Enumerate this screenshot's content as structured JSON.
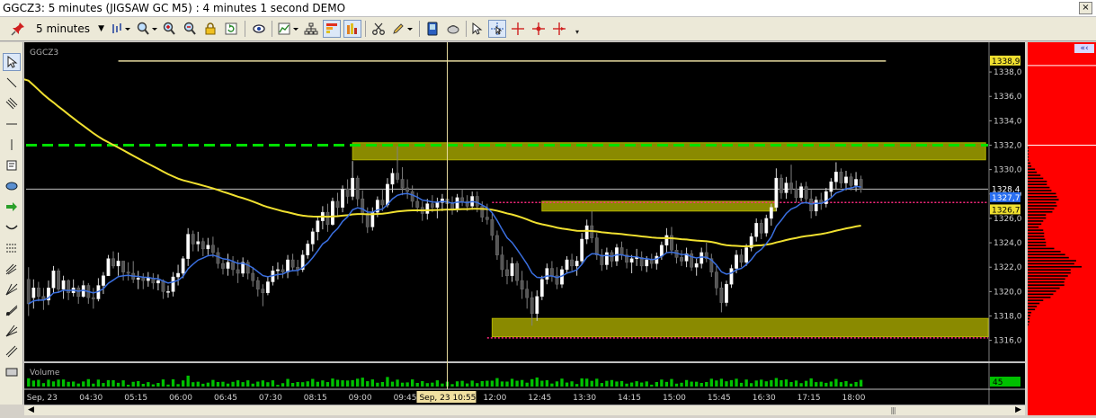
{
  "window": {
    "title": "GGCZ3: 5 minutes (JIGSAW GC M5) : 4 minutes 1 second DEMO",
    "close_label": "×"
  },
  "toolbar": {
    "interval": "5 minutes",
    "buttons": [
      "pin-icon",
      "bar-type-icon",
      "zoom-icon",
      "zoom-in-icon",
      "zoom-out-icon",
      "lock-icon",
      "refresh-icon",
      "eye-icon",
      "chart-type-icon",
      "hierarchy-icon",
      "grid-colors-icon",
      "columns-icon",
      "scissors-icon",
      "pencil-icon",
      "bell-icon",
      "phone-icon",
      "eraser-icon",
      "cursor-icon",
      "crosshair-icon",
      "crosshair-dot-icon",
      "crosshair-arrow-icon",
      "more-icon"
    ]
  },
  "chart": {
    "symbol": "GGCZ3",
    "volume_label": "Volume",
    "volume_value": "45",
    "price_labels": [
      "1338,0",
      "1336,0",
      "1334,0",
      "1332,0",
      "1330,0",
      "1328,0",
      "1326,0",
      "1324,0",
      "1322,0",
      "1320,0",
      "1318,0",
      "1316,0"
    ],
    "markers": {
      "high": "1338,9",
      "last": "1328,4",
      "ma_fast": "1327,7",
      "ma_slow": "1326,7"
    },
    "time_labels": [
      "Sep, 23",
      "04:30",
      "05:15",
      "06:00",
      "06:45",
      "07:30",
      "08:15",
      "09:00",
      "09:45",
      "12:00",
      "12:45",
      "13:30",
      "14:15",
      "15:00",
      "15:45",
      "16:30",
      "17:15",
      "18:00"
    ],
    "crosshair_time": "Sep, 23 10:55",
    "colors": {
      "background": "#000000",
      "up_candle": "#ffffff",
      "down_candle": "#555555",
      "ma_slow": "#f0e030",
      "ma_fast": "#3a6fe0",
      "zone": "#8a8a00",
      "dashed_line": "#00e000",
      "dotted_line": "#ff2a80",
      "volume": "#00c000",
      "profile": "#000000"
    }
  },
  "chart_data": {
    "type": "candlestick",
    "y_range": [
      1314.5,
      1339.7
    ],
    "x_range": [
      0,
      193
    ],
    "x_tick_indices": [
      0,
      12,
      21,
      30,
      39,
      48,
      57,
      66,
      75,
      93,
      102,
      111,
      120,
      129,
      138,
      147,
      156,
      165
    ],
    "crosshair_index": 84,
    "last_index": 170,
    "levels": {
      "high_line": 1338.9,
      "dashed_resistance": 1332.0,
      "last_price_line": 1328.4,
      "dotted_line_1": 1327.3,
      "dotted_line_2": 1316.2
    },
    "zones": [
      {
        "x": [
          65,
          192
        ],
        "y": [
          1330.8,
          1332.2
        ]
      },
      {
        "x": [
          103,
          150
        ],
        "y": [
          1326.6,
          1327.4
        ]
      },
      {
        "x": [
          93,
          198
        ],
        "y": [
          1316.3,
          1317.8
        ]
      }
    ],
    "candles": [
      {
        "o": 1321.0,
        "h": 1322.0,
        "l": 1318.0,
        "c": 1319.0
      },
      {
        "o": 1319.5,
        "h": 1321.0,
        "l": 1318.6,
        "c": 1320.3
      },
      {
        "o": 1320.3,
        "h": 1320.8,
        "l": 1319.2,
        "c": 1319.6
      },
      {
        "o": 1319.6,
        "h": 1320.3,
        "l": 1318.5,
        "c": 1319.3
      },
      {
        "o": 1319.3,
        "h": 1320.9,
        "l": 1318.9,
        "c": 1320.3
      },
      {
        "o": 1320.3,
        "h": 1322.1,
        "l": 1319.9,
        "c": 1321.7
      },
      {
        "o": 1321.7,
        "h": 1321.9,
        "l": 1319.9,
        "c": 1320.2
      },
      {
        "o": 1320.2,
        "h": 1321.3,
        "l": 1319.4,
        "c": 1320.9
      },
      {
        "o": 1320.9,
        "h": 1321.0,
        "l": 1319.3,
        "c": 1319.9
      },
      {
        "o": 1319.9,
        "h": 1321.0,
        "l": 1319.6,
        "c": 1320.3
      },
      {
        "o": 1320.3,
        "h": 1320.5,
        "l": 1319.0,
        "c": 1319.6
      },
      {
        "o": 1319.6,
        "h": 1320.9,
        "l": 1319.5,
        "c": 1320.5
      },
      {
        "o": 1320.5,
        "h": 1320.7,
        "l": 1319.0,
        "c": 1319.5
      },
      {
        "o": 1319.5,
        "h": 1320.3,
        "l": 1318.6,
        "c": 1319.4
      },
      {
        "o": 1319.4,
        "h": 1321.1,
        "l": 1319.2,
        "c": 1320.5
      },
      {
        "o": 1320.5,
        "h": 1321.6,
        "l": 1319.8,
        "c": 1321.3
      },
      {
        "o": 1321.3,
        "h": 1323.0,
        "l": 1321.3,
        "c": 1322.7
      },
      {
        "o": 1322.7,
        "h": 1323.3,
        "l": 1321.9,
        "c": 1322.1
      },
      {
        "o": 1322.1,
        "h": 1323.2,
        "l": 1321.3,
        "c": 1322.5
      },
      {
        "o": 1322.5,
        "h": 1322.5,
        "l": 1320.9,
        "c": 1321.6
      },
      {
        "o": 1321.6,
        "h": 1322.4,
        "l": 1320.9,
        "c": 1321.5
      },
      {
        "o": 1321.5,
        "h": 1322.5,
        "l": 1320.7,
        "c": 1321.0
      },
      {
        "o": 1321.0,
        "h": 1321.7,
        "l": 1320.2,
        "c": 1321.1
      },
      {
        "o": 1321.1,
        "h": 1321.5,
        "l": 1320.2,
        "c": 1320.9
      },
      {
        "o": 1320.9,
        "h": 1321.6,
        "l": 1320.4,
        "c": 1321.1
      },
      {
        "o": 1321.1,
        "h": 1321.5,
        "l": 1320.2,
        "c": 1320.7
      },
      {
        "o": 1320.7,
        "h": 1321.4,
        "l": 1320.1,
        "c": 1320.9
      },
      {
        "o": 1320.9,
        "h": 1321.0,
        "l": 1319.4,
        "c": 1320.0
      },
      {
        "o": 1320.0,
        "h": 1320.5,
        "l": 1319.5,
        "c": 1320.0
      },
      {
        "o": 1320.0,
        "h": 1321.6,
        "l": 1319.6,
        "c": 1321.2
      },
      {
        "o": 1321.2,
        "h": 1322.2,
        "l": 1320.5,
        "c": 1321.5
      },
      {
        "o": 1321.5,
        "h": 1322.9,
        "l": 1321.1,
        "c": 1322.7
      },
      {
        "o": 1322.7,
        "h": 1325.2,
        "l": 1322.1,
        "c": 1324.7
      },
      {
        "o": 1324.7,
        "h": 1325.0,
        "l": 1323.3,
        "c": 1323.9
      },
      {
        "o": 1323.9,
        "h": 1324.9,
        "l": 1323.3,
        "c": 1324.1
      },
      {
        "o": 1324.1,
        "h": 1324.4,
        "l": 1322.9,
        "c": 1323.5
      },
      {
        "o": 1323.5,
        "h": 1324.4,
        "l": 1323.0,
        "c": 1323.8
      },
      {
        "o": 1323.8,
        "h": 1324.5,
        "l": 1322.8,
        "c": 1323.2
      },
      {
        "o": 1323.2,
        "h": 1323.6,
        "l": 1321.9,
        "c": 1322.3
      },
      {
        "o": 1322.3,
        "h": 1322.6,
        "l": 1321.4,
        "c": 1321.9
      },
      {
        "o": 1321.9,
        "h": 1323.1,
        "l": 1321.3,
        "c": 1322.4
      },
      {
        "o": 1322.4,
        "h": 1322.9,
        "l": 1321.3,
        "c": 1321.8
      },
      {
        "o": 1321.8,
        "h": 1322.6,
        "l": 1320.7,
        "c": 1321.5
      },
      {
        "o": 1321.5,
        "h": 1322.8,
        "l": 1321.2,
        "c": 1322.4
      },
      {
        "o": 1322.4,
        "h": 1322.6,
        "l": 1321.0,
        "c": 1321.5
      },
      {
        "o": 1321.5,
        "h": 1322.0,
        "l": 1320.4,
        "c": 1320.9
      },
      {
        "o": 1320.9,
        "h": 1321.2,
        "l": 1319.6,
        "c": 1320.2
      },
      {
        "o": 1320.2,
        "h": 1320.6,
        "l": 1318.8,
        "c": 1319.9
      },
      {
        "o": 1319.9,
        "h": 1321.2,
        "l": 1319.7,
        "c": 1320.8
      },
      {
        "o": 1320.8,
        "h": 1322.1,
        "l": 1320.5,
        "c": 1321.7
      },
      {
        "o": 1321.7,
        "h": 1322.4,
        "l": 1321.0,
        "c": 1321.8
      },
      {
        "o": 1321.8,
        "h": 1322.2,
        "l": 1321.1,
        "c": 1321.6
      },
      {
        "o": 1321.6,
        "h": 1323.0,
        "l": 1321.1,
        "c": 1322.6
      },
      {
        "o": 1322.6,
        "h": 1323.1,
        "l": 1321.7,
        "c": 1322.0
      },
      {
        "o": 1322.0,
        "h": 1322.6,
        "l": 1321.3,
        "c": 1321.8
      },
      {
        "o": 1321.8,
        "h": 1323.4,
        "l": 1321.6,
        "c": 1323.0
      },
      {
        "o": 1323.0,
        "h": 1324.2,
        "l": 1322.7,
        "c": 1323.9
      },
      {
        "o": 1323.9,
        "h": 1325.2,
        "l": 1323.3,
        "c": 1324.9
      },
      {
        "o": 1324.9,
        "h": 1326.1,
        "l": 1324.2,
        "c": 1325.8
      },
      {
        "o": 1325.8,
        "h": 1327.0,
        "l": 1325.1,
        "c": 1326.5
      },
      {
        "o": 1326.5,
        "h": 1327.2,
        "l": 1324.9,
        "c": 1325.5
      },
      {
        "o": 1325.5,
        "h": 1327.7,
        "l": 1325.4,
        "c": 1327.4
      },
      {
        "o": 1327.4,
        "h": 1328.1,
        "l": 1326.1,
        "c": 1326.9
      },
      {
        "o": 1326.9,
        "h": 1328.7,
        "l": 1326.5,
        "c": 1328.4
      },
      {
        "o": 1328.4,
        "h": 1329.2,
        "l": 1327.2,
        "c": 1327.8
      },
      {
        "o": 1327.8,
        "h": 1330.7,
        "l": 1327.5,
        "c": 1329.3
      },
      {
        "o": 1329.3,
        "h": 1329.5,
        "l": 1327.0,
        "c": 1327.6
      },
      {
        "o": 1327.6,
        "h": 1328.3,
        "l": 1325.6,
        "c": 1326.4
      },
      {
        "o": 1326.4,
        "h": 1326.9,
        "l": 1324.8,
        "c": 1325.3
      },
      {
        "o": 1325.3,
        "h": 1326.9,
        "l": 1325.0,
        "c": 1326.5
      },
      {
        "o": 1326.5,
        "h": 1327.8,
        "l": 1326.1,
        "c": 1327.5
      },
      {
        "o": 1327.5,
        "h": 1328.4,
        "l": 1326.6,
        "c": 1327.1
      },
      {
        "o": 1327.1,
        "h": 1329.3,
        "l": 1326.9,
        "c": 1328.8
      },
      {
        "o": 1328.8,
        "h": 1330.1,
        "l": 1328.1,
        "c": 1329.7
      },
      {
        "o": 1329.7,
        "h": 1331.9,
        "l": 1328.9,
        "c": 1329.2
      },
      {
        "o": 1329.2,
        "h": 1330.2,
        "l": 1327.9,
        "c": 1328.5
      },
      {
        "o": 1328.5,
        "h": 1329.2,
        "l": 1327.6,
        "c": 1328.2
      },
      {
        "o": 1328.2,
        "h": 1328.7,
        "l": 1326.9,
        "c": 1327.4
      },
      {
        "o": 1327.4,
        "h": 1328.1,
        "l": 1326.5,
        "c": 1326.9
      },
      {
        "o": 1326.9,
        "h": 1327.4,
        "l": 1325.8,
        "c": 1326.4
      },
      {
        "o": 1326.4,
        "h": 1327.6,
        "l": 1325.9,
        "c": 1327.2
      },
      {
        "o": 1327.2,
        "h": 1327.9,
        "l": 1326.5,
        "c": 1326.9
      },
      {
        "o": 1326.9,
        "h": 1327.7,
        "l": 1326.0,
        "c": 1327.3
      },
      {
        "o": 1327.3,
        "h": 1328.0,
        "l": 1326.6,
        "c": 1327.6
      },
      {
        "o": 1327.6,
        "h": 1328.1,
        "l": 1326.8,
        "c": 1327.2
      },
      {
        "o": 1327.2,
        "h": 1327.8,
        "l": 1326.3,
        "c": 1326.8
      },
      {
        "o": 1326.8,
        "h": 1328.0,
        "l": 1326.5,
        "c": 1327.7
      },
      {
        "o": 1327.7,
        "h": 1328.4,
        "l": 1327.0,
        "c": 1327.4
      },
      {
        "o": 1327.4,
        "h": 1327.9,
        "l": 1326.6,
        "c": 1327.0
      },
      {
        "o": 1327.0,
        "h": 1328.2,
        "l": 1326.7,
        "c": 1327.8
      },
      {
        "o": 1327.8,
        "h": 1328.2,
        "l": 1326.5,
        "c": 1327.0
      },
      {
        "o": 1327.0,
        "h": 1327.4,
        "l": 1325.7,
        "c": 1326.1
      },
      {
        "o": 1326.1,
        "h": 1327.2,
        "l": 1325.5,
        "c": 1325.9
      },
      {
        "o": 1325.9,
        "h": 1326.4,
        "l": 1324.2,
        "c": 1324.6
      },
      {
        "o": 1324.6,
        "h": 1325.0,
        "l": 1322.6,
        "c": 1323.0
      },
      {
        "o": 1323.0,
        "h": 1323.7,
        "l": 1321.2,
        "c": 1321.8
      },
      {
        "o": 1321.8,
        "h": 1322.6,
        "l": 1320.6,
        "c": 1321.3
      },
      {
        "o": 1321.3,
        "h": 1322.8,
        "l": 1320.8,
        "c": 1322.3
      },
      {
        "o": 1322.3,
        "h": 1322.5,
        "l": 1320.5,
        "c": 1320.9
      },
      {
        "o": 1320.9,
        "h": 1321.7,
        "l": 1319.4,
        "c": 1320.2
      },
      {
        "o": 1320.2,
        "h": 1320.9,
        "l": 1318.6,
        "c": 1319.5
      },
      {
        "o": 1319.5,
        "h": 1320.0,
        "l": 1317.2,
        "c": 1318.2
      },
      {
        "o": 1318.2,
        "h": 1320.1,
        "l": 1317.6,
        "c": 1319.6
      },
      {
        "o": 1319.6,
        "h": 1321.3,
        "l": 1319.3,
        "c": 1321.0
      },
      {
        "o": 1321.0,
        "h": 1322.3,
        "l": 1320.6,
        "c": 1321.9
      },
      {
        "o": 1321.9,
        "h": 1322.5,
        "l": 1320.8,
        "c": 1321.3
      },
      {
        "o": 1321.3,
        "h": 1322.0,
        "l": 1320.2,
        "c": 1320.6
      },
      {
        "o": 1320.6,
        "h": 1322.1,
        "l": 1320.3,
        "c": 1321.8
      },
      {
        "o": 1321.8,
        "h": 1322.9,
        "l": 1321.5,
        "c": 1322.6
      },
      {
        "o": 1322.6,
        "h": 1323.1,
        "l": 1321.7,
        "c": 1322.1
      },
      {
        "o": 1322.1,
        "h": 1322.9,
        "l": 1321.3,
        "c": 1322.5
      },
      {
        "o": 1322.5,
        "h": 1324.8,
        "l": 1322.2,
        "c": 1324.3
      },
      {
        "o": 1324.3,
        "h": 1325.9,
        "l": 1323.9,
        "c": 1325.4
      },
      {
        "o": 1325.4,
        "h": 1326.6,
        "l": 1324.0,
        "c": 1324.4
      },
      {
        "o": 1324.4,
        "h": 1324.8,
        "l": 1322.6,
        "c": 1323.0
      },
      {
        "o": 1323.0,
        "h": 1323.5,
        "l": 1321.7,
        "c": 1322.2
      },
      {
        "o": 1322.2,
        "h": 1323.6,
        "l": 1321.8,
        "c": 1323.2
      },
      {
        "o": 1323.2,
        "h": 1323.4,
        "l": 1322.0,
        "c": 1322.5
      },
      {
        "o": 1322.5,
        "h": 1323.9,
        "l": 1322.1,
        "c": 1323.6
      },
      {
        "o": 1323.6,
        "h": 1324.1,
        "l": 1322.6,
        "c": 1323.0
      },
      {
        "o": 1323.0,
        "h": 1323.5,
        "l": 1321.9,
        "c": 1322.4
      },
      {
        "o": 1322.4,
        "h": 1323.0,
        "l": 1321.5,
        "c": 1322.7
      },
      {
        "o": 1322.7,
        "h": 1323.5,
        "l": 1322.1,
        "c": 1322.8
      },
      {
        "o": 1322.8,
        "h": 1323.3,
        "l": 1321.7,
        "c": 1322.1
      },
      {
        "o": 1322.1,
        "h": 1322.9,
        "l": 1321.6,
        "c": 1322.6
      },
      {
        "o": 1322.6,
        "h": 1323.1,
        "l": 1321.9,
        "c": 1322.3
      },
      {
        "o": 1322.3,
        "h": 1323.2,
        "l": 1321.8,
        "c": 1322.9
      },
      {
        "o": 1322.9,
        "h": 1324.1,
        "l": 1322.6,
        "c": 1323.8
      },
      {
        "o": 1323.8,
        "h": 1325.2,
        "l": 1323.2,
        "c": 1324.6
      },
      {
        "o": 1324.6,
        "h": 1325.3,
        "l": 1323.0,
        "c": 1323.4
      },
      {
        "o": 1323.4,
        "h": 1323.9,
        "l": 1322.3,
        "c": 1322.8
      },
      {
        "o": 1322.8,
        "h": 1323.4,
        "l": 1322.1,
        "c": 1322.5
      },
      {
        "o": 1322.5,
        "h": 1323.6,
        "l": 1322.0,
        "c": 1323.1
      },
      {
        "o": 1323.1,
        "h": 1323.4,
        "l": 1321.7,
        "c": 1322.0
      },
      {
        "o": 1322.0,
        "h": 1322.7,
        "l": 1321.3,
        "c": 1322.3
      },
      {
        "o": 1322.3,
        "h": 1323.6,
        "l": 1321.9,
        "c": 1323.2
      },
      {
        "o": 1323.2,
        "h": 1324.0,
        "l": 1322.4,
        "c": 1322.7
      },
      {
        "o": 1322.7,
        "h": 1323.1,
        "l": 1321.2,
        "c": 1321.6
      },
      {
        "o": 1321.6,
        "h": 1322.1,
        "l": 1319.7,
        "c": 1320.3
      },
      {
        "o": 1320.3,
        "h": 1320.8,
        "l": 1318.3,
        "c": 1319.1
      },
      {
        "o": 1319.1,
        "h": 1320.9,
        "l": 1318.8,
        "c": 1320.6
      },
      {
        "o": 1320.6,
        "h": 1322.2,
        "l": 1320.3,
        "c": 1321.9
      },
      {
        "o": 1321.9,
        "h": 1323.4,
        "l": 1321.5,
        "c": 1323.0
      },
      {
        "o": 1323.0,
        "h": 1323.5,
        "l": 1322.0,
        "c": 1322.4
      },
      {
        "o": 1322.4,
        "h": 1323.9,
        "l": 1322.1,
        "c": 1323.6
      },
      {
        "o": 1323.6,
        "h": 1324.8,
        "l": 1323.3,
        "c": 1324.5
      },
      {
        "o": 1324.5,
        "h": 1326.0,
        "l": 1324.1,
        "c": 1325.6
      },
      {
        "o": 1325.6,
        "h": 1325.9,
        "l": 1324.3,
        "c": 1324.8
      },
      {
        "o": 1324.8,
        "h": 1326.3,
        "l": 1324.5,
        "c": 1326.0
      },
      {
        "o": 1326.0,
        "h": 1327.2,
        "l": 1325.4,
        "c": 1326.9
      },
      {
        "o": 1326.9,
        "h": 1330.1,
        "l": 1326.6,
        "c": 1329.3
      },
      {
        "o": 1329.3,
        "h": 1329.6,
        "l": 1327.6,
        "c": 1328.1
      },
      {
        "o": 1328.1,
        "h": 1329.4,
        "l": 1327.6,
        "c": 1328.9
      },
      {
        "o": 1328.9,
        "h": 1330.4,
        "l": 1328.0,
        "c": 1328.4
      },
      {
        "o": 1328.4,
        "h": 1329.1,
        "l": 1327.3,
        "c": 1327.7
      },
      {
        "o": 1327.7,
        "h": 1328.9,
        "l": 1327.4,
        "c": 1328.6
      },
      {
        "o": 1328.6,
        "h": 1329.0,
        "l": 1327.2,
        "c": 1327.6
      },
      {
        "o": 1327.6,
        "h": 1328.4,
        "l": 1326.0,
        "c": 1326.6
      },
      {
        "o": 1326.6,
        "h": 1327.8,
        "l": 1326.2,
        "c": 1327.5
      },
      {
        "o": 1327.5,
        "h": 1328.1,
        "l": 1326.7,
        "c": 1327.2
      },
      {
        "o": 1327.2,
        "h": 1328.5,
        "l": 1326.9,
        "c": 1328.2
      },
      {
        "o": 1328.2,
        "h": 1329.3,
        "l": 1327.8,
        "c": 1329.0
      },
      {
        "o": 1329.0,
        "h": 1330.6,
        "l": 1328.4,
        "c": 1329.8
      },
      {
        "o": 1329.8,
        "h": 1330.1,
        "l": 1328.5,
        "c": 1328.9
      },
      {
        "o": 1328.9,
        "h": 1329.9,
        "l": 1328.3,
        "c": 1329.4
      },
      {
        "o": 1329.4,
        "h": 1329.7,
        "l": 1328.3,
        "c": 1328.7
      },
      {
        "o": 1328.7,
        "h": 1329.8,
        "l": 1328.2,
        "c": 1329.2
      },
      {
        "o": 1329.2,
        "h": 1329.5,
        "l": 1328.1,
        "c": 1328.4
      }
    ]
  }
}
